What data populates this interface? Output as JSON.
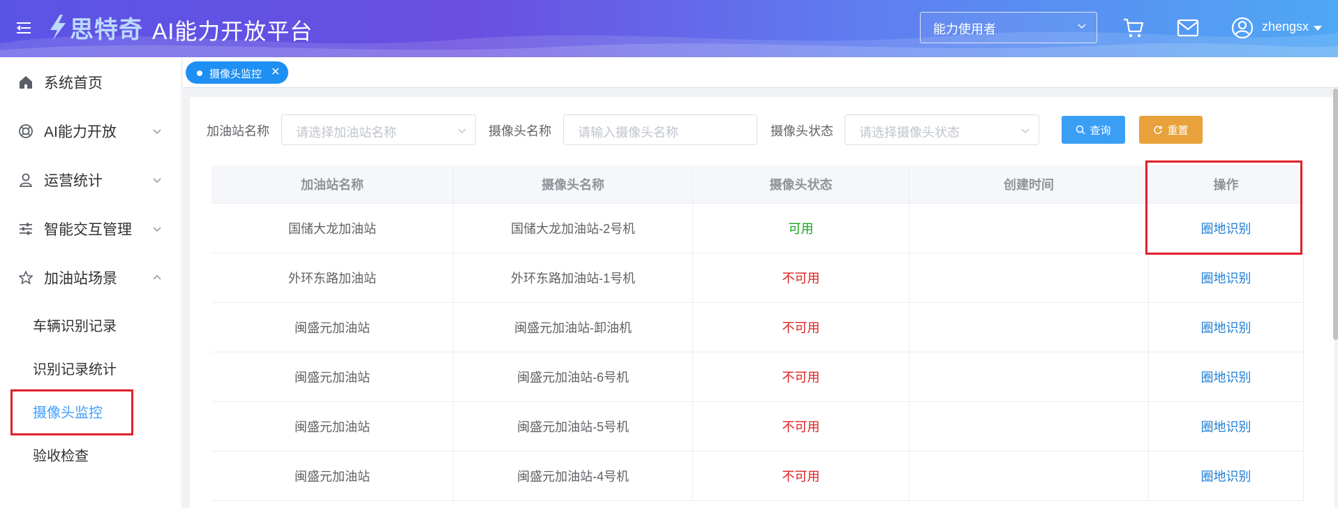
{
  "header": {
    "logo_text": "思特奇",
    "platform_title": "AI能力开放平台",
    "role_select": "能力使用者",
    "username": "zhengsx"
  },
  "sidebar": {
    "items": [
      {
        "label": "系统首页",
        "icon": "home-icon"
      },
      {
        "label": "AI能力开放",
        "icon": "ai-icon"
      },
      {
        "label": "运营统计",
        "icon": "user-stats-icon"
      },
      {
        "label": "智能交互管理",
        "icon": "sliders-icon"
      },
      {
        "label": "加油站场景",
        "icon": "star-icon"
      }
    ],
    "sub_items": [
      {
        "label": "车辆识别记录"
      },
      {
        "label": "识别记录统计"
      },
      {
        "label": "摄像头监控"
      },
      {
        "label": "验收检查"
      }
    ]
  },
  "tabs": {
    "active_tag": "摄像头监控"
  },
  "filters": {
    "station_label": "加油站名称",
    "station_placeholder": "请选择加油站名称",
    "camera_label": "摄像头名称",
    "camera_placeholder": "请输入摄像头名称",
    "status_label": "摄像头状态",
    "status_placeholder": "请选择摄像头状态",
    "query_button": "查询",
    "reset_button": "重置"
  },
  "table": {
    "headers": [
      "加油站名称",
      "摄像头名称",
      "摄像头状态",
      "创建时间",
      "操作"
    ],
    "rows": [
      {
        "station": "国储大龙加油站",
        "camera": "国储大龙加油站-2号机",
        "status": "可用",
        "created": "",
        "action": "圈地识别"
      },
      {
        "station": "外环东路加油站",
        "camera": "外环东路加油站-1号机",
        "status": "不可用",
        "created": "",
        "action": "圈地识别"
      },
      {
        "station": "闽盛元加油站",
        "camera": "闽盛元加油站-卸油机",
        "status": "不可用",
        "created": "",
        "action": "圈地识别"
      },
      {
        "station": "闽盛元加油站",
        "camera": "闽盛元加油站-6号机",
        "status": "不可用",
        "created": "",
        "action": "圈地识别"
      },
      {
        "station": "闽盛元加油站",
        "camera": "闽盛元加油站-5号机",
        "status": "不可用",
        "created": "",
        "action": "圈地识别"
      },
      {
        "station": "闽盛元加油站",
        "camera": "闽盛元加油站-4号机",
        "status": "不可用",
        "created": "",
        "action": "圈地识别"
      }
    ]
  },
  "colors": {
    "accent": "#409eff",
    "ok": "#13a51a",
    "bad": "#e02020",
    "query_btn": "#3a9ef5",
    "reset_btn": "#e9a23b",
    "highlight": "#e0202a"
  }
}
